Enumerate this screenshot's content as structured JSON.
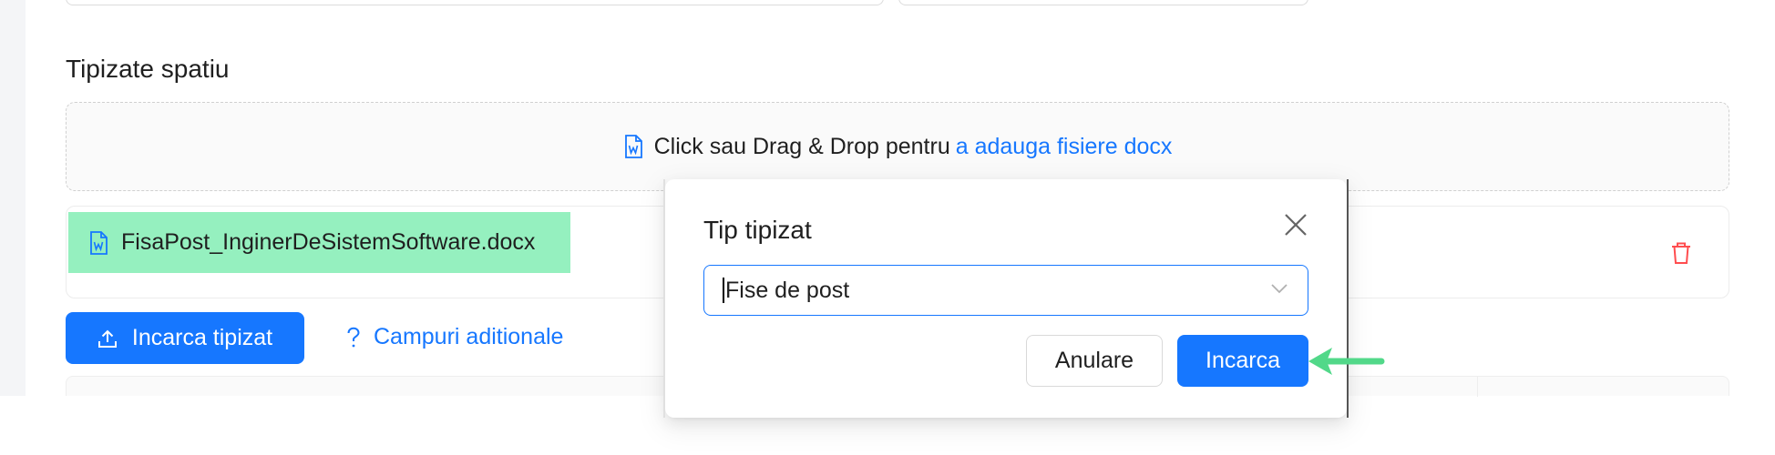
{
  "section": {
    "title": "Tipizate spatiu"
  },
  "dropzone": {
    "text": "Click sau Drag & Drop pentru",
    "link": "a adauga fisiere docx",
    "icon": "docx-file-icon"
  },
  "file_list": [
    {
      "name": "FisaPost_InginerDeSistemSoftware.docx",
      "icon": "docx-file-icon",
      "action_icon": "trash-icon"
    }
  ],
  "actions": {
    "upload_label": "Incarca tipizat",
    "help_label": "Campuri aditionale"
  },
  "modal": {
    "title": "Tip tipizat",
    "select_value": "Fise de post",
    "cancel_label": "Anulare",
    "ok_label": "Incarca"
  },
  "colors": {
    "primary": "#1677ff",
    "highlight": "#95f0bf",
    "danger": "#ff4d4f",
    "arrow": "#52d889"
  }
}
